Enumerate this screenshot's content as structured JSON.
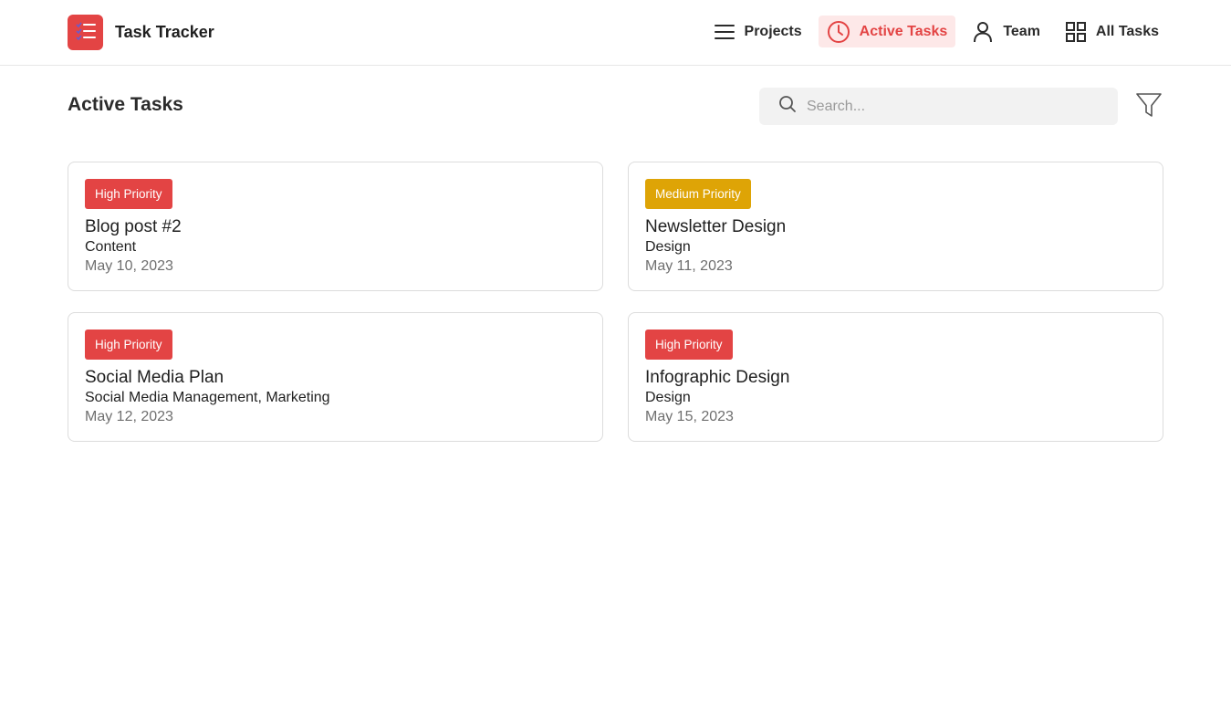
{
  "app": {
    "name": "Task Tracker",
    "logo_icon": "checklist-icon",
    "accent": "#e34444"
  },
  "nav": {
    "items": [
      {
        "label": "Projects",
        "icon": "menu-lines-icon",
        "active": false
      },
      {
        "label": "Active Tasks",
        "icon": "clock-icon",
        "active": true
      },
      {
        "label": "Team",
        "icon": "user-icon",
        "active": false
      },
      {
        "label": "All Tasks",
        "icon": "grid-icon",
        "active": false
      }
    ]
  },
  "main": {
    "title": "Active Tasks",
    "search": {
      "placeholder": "Search...",
      "value": "",
      "icon": "search-icon"
    },
    "filter_icon": "filter-icon"
  },
  "tasks": [
    {
      "priority": "High Priority",
      "priority_color": "#e34444",
      "title": "Blog post #2",
      "category": "Content",
      "date": "May 10, 2023"
    },
    {
      "priority": "Medium Priority",
      "priority_color": "#dea406",
      "title": "Newsletter Design",
      "category": "Design",
      "date": "May 11, 2023"
    },
    {
      "priority": "High Priority",
      "priority_color": "#e34444",
      "title": "Social Media Plan",
      "category": "Social Media Management, Marketing",
      "date": "May 12, 2023"
    },
    {
      "priority": "High Priority",
      "priority_color": "#e34444",
      "title": "Infographic Design",
      "category": "Design",
      "date": "May 15, 2023"
    }
  ]
}
